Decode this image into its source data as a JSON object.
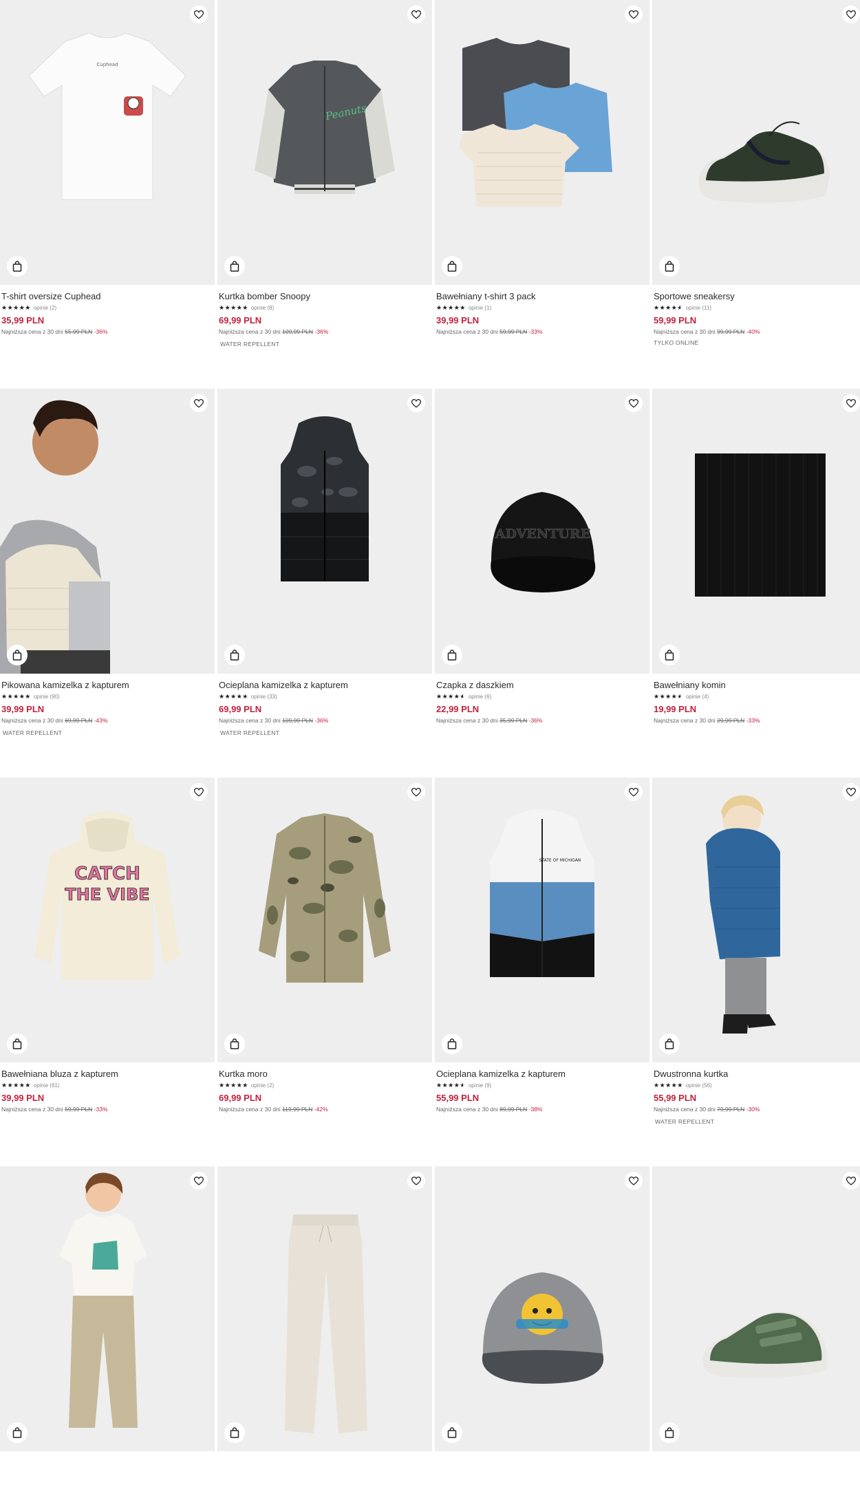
{
  "products": [
    {
      "name": "T-shirt oversize Cuphead",
      "rating": 5,
      "reviews": "opinie (2)",
      "price": "35,99 PLN",
      "lowest_label": "Najniższa cena z 30 dni",
      "old_price": "55,99 PLN",
      "discount": "-36%",
      "tag": "",
      "art": "tshirt"
    },
    {
      "name": "Kurtka bomber Snoopy",
      "rating": 5,
      "reviews": "opinie (8)",
      "price": "69,99 PLN",
      "lowest_label": "Najniższa cena z 30 dni",
      "old_price": "109,99 PLN",
      "discount": "-36%",
      "tag": "WATER REPELLENT",
      "art": "bomber"
    },
    {
      "name": "Bawełniany t-shirt 3 pack",
      "rating": 5,
      "reviews": "opinie (1)",
      "price": "39,99 PLN",
      "lowest_label": "Najniższa cena z 30 dni",
      "old_price": "59,99 PLN",
      "discount": "-33%",
      "tag": "",
      "art": "threepack"
    },
    {
      "name": "Sportowe sneakersy",
      "rating": 4.5,
      "reviews": "opinie (11)",
      "price": "59,99 PLN",
      "lowest_label": "Najniższa cena z 30 dni",
      "old_price": "99,99 PLN",
      "discount": "-40%",
      "tag": "TYLKO ONLINE",
      "art": "sneaker"
    },
    {
      "name": "Pikowana kamizelka z kapturem",
      "rating": 5,
      "reviews": "opinie (90)",
      "price": "39,99 PLN",
      "lowest_label": "Najniższa cena z 30 dni",
      "old_price": "69,99 PLN",
      "discount": "-43%",
      "tag": "WATER REPELLENT",
      "art": "kidvest"
    },
    {
      "name": "Ocieplana kamizelka z kapturem",
      "rating": 5,
      "reviews": "opinie (33)",
      "price": "69,99 PLN",
      "lowest_label": "Najniższa cena z 30 dni",
      "old_price": "109,99 PLN",
      "discount": "-36%",
      "tag": "WATER REPELLENT",
      "art": "camovest"
    },
    {
      "name": "Czapka z daszkiem",
      "rating": 4.5,
      "reviews": "opinie (6)",
      "price": "22,99 PLN",
      "lowest_label": "Najniższa cena z 30 dni",
      "old_price": "35,99 PLN",
      "discount": "-36%",
      "tag": "",
      "art": "cap"
    },
    {
      "name": "Bawełniany komin",
      "rating": 4.5,
      "reviews": "opinie (4)",
      "price": "19,99 PLN",
      "lowest_label": "Najniższa cena z 30 dni",
      "old_price": "29,99 PLN",
      "discount": "-33%",
      "tag": "",
      "art": "scarf"
    },
    {
      "name": "Bawełniana bluza z kapturem",
      "rating": 5,
      "reviews": "opinie (61)",
      "price": "39,99 PLN",
      "lowest_label": "Najniższa cena z 30 dni",
      "old_price": "59,99 PLN",
      "discount": "-33%",
      "tag": "",
      "art": "hoodie"
    },
    {
      "name": "Kurtka moro",
      "rating": 5,
      "reviews": "opinie (2)",
      "price": "69,99 PLN",
      "lowest_label": "Najniższa cena z 30 dni",
      "old_price": "119,99 PLN",
      "discount": "-42%",
      "tag": "",
      "art": "camojacket"
    },
    {
      "name": "Ocieplana kamizelka z kapturem",
      "rating": 4.5,
      "reviews": "opinie (9)",
      "price": "55,99 PLN",
      "lowest_label": "Najniższa cena z 30 dni",
      "old_price": "89,99 PLN",
      "discount": "-38%",
      "tag": "",
      "art": "bluevest"
    },
    {
      "name": "Dwustronna kurtka",
      "rating": 5,
      "reviews": "opinie (56)",
      "price": "55,99 PLN",
      "lowest_label": "Najniższa cena z 30 dni",
      "old_price": "79,99 PLN",
      "discount": "-30%",
      "tag": "WATER REPELLENT",
      "art": "kidjacket"
    },
    {
      "name": "",
      "rating": 0,
      "reviews": "",
      "price": "",
      "lowest_label": "",
      "old_price": "",
      "discount": "",
      "tag": "",
      "art": "kidtee"
    },
    {
      "name": "",
      "rating": 0,
      "reviews": "",
      "price": "",
      "lowest_label": "",
      "old_price": "",
      "discount": "",
      "tag": "",
      "art": "pants"
    },
    {
      "name": "",
      "rating": 0,
      "reviews": "",
      "price": "",
      "lowest_label": "",
      "old_price": "",
      "discount": "",
      "tag": "",
      "art": "graycap"
    },
    {
      "name": "",
      "rating": 0,
      "reviews": "",
      "price": "",
      "lowest_label": "",
      "old_price": "",
      "discount": "",
      "tag": "",
      "art": "greenshoe"
    }
  ],
  "icons": {
    "favorite": "heart-icon",
    "add_to_cart": "shopping-bag-icon"
  },
  "colors": {
    "price": "#c3213f",
    "image_bg": "#eeeeef"
  }
}
